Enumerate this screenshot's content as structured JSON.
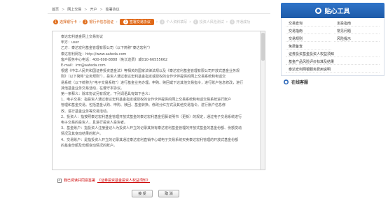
{
  "breadcrumb": [
    "首页",
    "网上交易",
    "开户",
    "签署协议"
  ],
  "steps": [
    {
      "num": "1",
      "label": "选择银行卡",
      "state": "done"
    },
    {
      "num": "2",
      "label": "银行卡信息验证",
      "state": "done"
    },
    {
      "num": "3",
      "label": "签署交易协议",
      "state": "current"
    },
    {
      "num": "4",
      "label": "个人资料填写",
      "state": "todo"
    },
    {
      "num": "5",
      "label": "投资人风险测试",
      "state": "todo"
    },
    {
      "num": "6",
      "label": "开通成功",
      "state": "todo"
    }
  ],
  "agreement": {
    "lines": [
      "泰达宏利基金网上交易协议",
      "甲方：user",
      "乙方：泰达宏利基金管理有限公司（以下简称“泰达宏利”）",
      "泰达宏利网址：http://www.aateda.com",
      "客户服务中心电话：400-698-8888（免长途费）或010-66555662",
      "E-mail：irm@aateda.com",
      "根据《中华人民共和国证券投资基金法》等相关的国家法律法规以及《泰达宏利基金管理有限公司开放式基金业务规",
      "则》（以下简称“业务规则”），投资人通过泰达宏利基金指定或授权的合作伙伴提供的网上交易系统和电话交",
      "易系统（以下统称为“电子交易系统”）进行基金业务办理。申购、赎回或下达其他交易指令，进行账户信息修改，进行",
      "其他基金业务交易活动，在遵守本协议。",
      "第一条释义：除本协议另有规定，下列词语具有如下含义：",
      "1、电子交易：指投资人通过泰达宏利基金指定或授权的合作伙伴提供的网上交易系统和电话交易系统进行账户",
      "管理和基金交易。包括基金认购、申购、赎回、基金转换、修改分红方式及其他交易指令。进行账户信息修",
      "改、进行基金业务等交易活动。",
      "2、投资人：指按照泰达宏利基金管理开放式基金的泰达宏利基金招募说明书（更新）的规定，通过电子交易系统进行",
      "电子交易的投资人，且进行投资人投资者。",
      "3、基金账户：指投资人注册登记人为投资人开立的记录其持有泰达宏利基金管理的开放式基金的基金份额、份额变动",
      "情况及其变动结果的账户。",
      "4、交易账户：是指投资人开立的记录其通过泰达宏利直销中心或电子交易系统买卖泰达宏利管理的开放式基金份额",
      "的基金份额及份额变动情况的账户。"
    ]
  },
  "agree": {
    "checked": "✓",
    "text": "我已阅读并同意签署",
    "link_text": "《证券投资基金投资人权益须知》"
  },
  "buttons": {
    "ok": "接 受",
    "cancel": "取 消"
  },
  "sidebar": {
    "title": "贴心工具",
    "tools": [
      "交易查询",
      "定投指南",
      "交易指南",
      "常见问题",
      "交易规则",
      "风险提示",
      "免费备查"
    ],
    "wide_links": [
      "证券投资基金投资人权益须知",
      "基金产品风险评价标准及结果",
      "泰达宏利网银服务费用说明"
    ],
    "online_service": "在线客服"
  },
  "colors": {
    "accent_orange": "#e06a1a",
    "header_blue": "#1d5aa8",
    "link_red": "#cc0000"
  }
}
